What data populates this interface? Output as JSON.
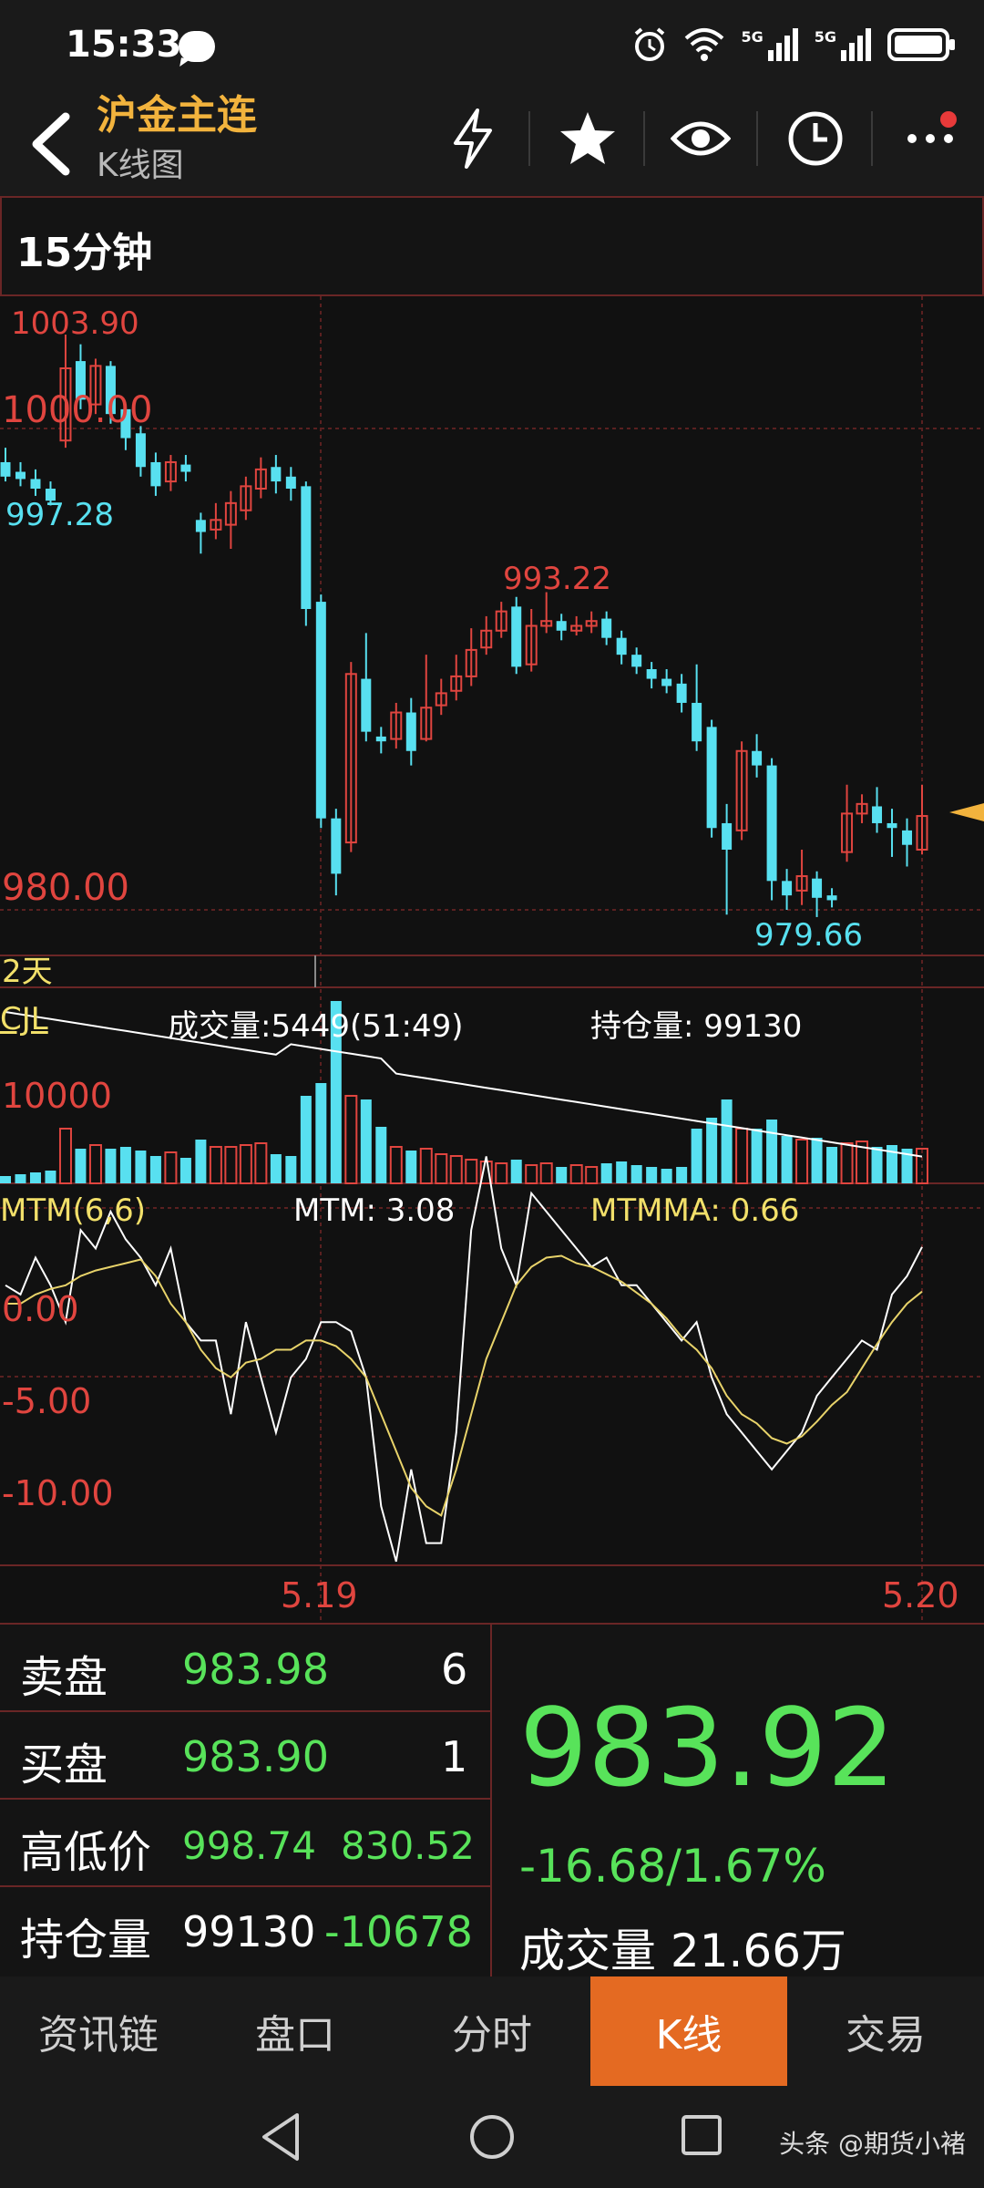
{
  "status": {
    "time": "15:33",
    "net1": "5G",
    "net2": "5G"
  },
  "header": {
    "title": "沪金主连",
    "subtitle": "K线图"
  },
  "period": {
    "label": "15分钟"
  },
  "kchart": {
    "price_high": "1003.90",
    "price_1000": "1000.00",
    "price_997": "997.28",
    "price_993": "993.22",
    "price_980": "980.00",
    "price_low": "979.66",
    "days": "2天"
  },
  "vol": {
    "indicator": "CJL",
    "volume_text": "成交量:5449(51:49)",
    "oi_text": "持仓量: 99130",
    "axis_10000": "10000"
  },
  "mtm": {
    "indicator": "MTM(6,6)",
    "mtm_text": "MTM: 3.08",
    "mtmma_text": "MTMMA: 0.66",
    "axis_0": "0.00",
    "axis_m5": "-5.00",
    "axis_m10": "-10.00"
  },
  "dates": {
    "d1": "5.19",
    "d2": "5.20"
  },
  "quote": {
    "sell_label": "卖盘",
    "sell_price": "983.98",
    "sell_qty": "6",
    "buy_label": "买盘",
    "buy_price": "983.90",
    "buy_qty": "1",
    "hl_label": "高低价",
    "high": "998.74",
    "low": "830.52",
    "oi_label": "持仓量",
    "oi": "99130",
    "oi_chg": "-10678",
    "last": "983.92",
    "change": "-16.68/1.67%",
    "vol_label": "成交量 21.66万"
  },
  "tabs": [
    "资讯链",
    "盘口",
    "分时",
    "K线",
    "交易"
  ],
  "watermark": "头条 @期货小褚",
  "colors": {
    "up": "#e0453f",
    "down": "#58e0f0",
    "gold": "#f2b33d",
    "green": "#58e35a",
    "grid": "#6a2626"
  }
}
